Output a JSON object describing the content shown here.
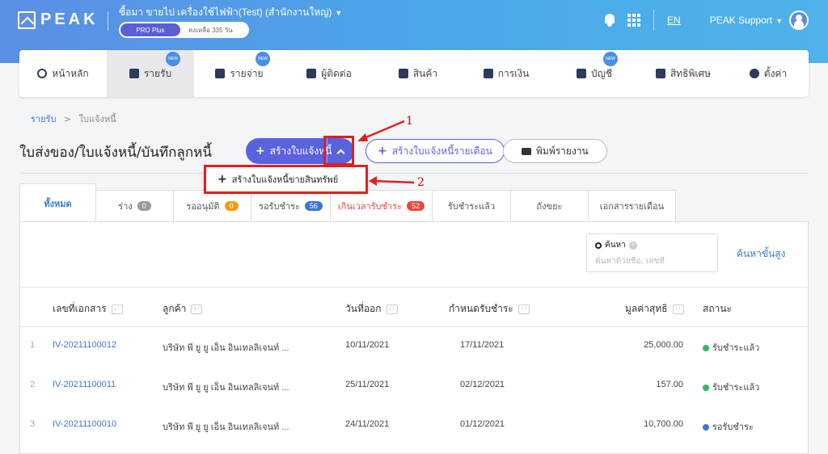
{
  "header": {
    "logo": "PEAK",
    "company": "ซื้อมา ขายไป เครื่องใช้ไฟฟ้า(Test) (สำนักงานใหญ่)",
    "plan": "PRO Plus",
    "days_left": "คงเหลือ 335 วัน",
    "language": "EN",
    "user": "PEAK Support"
  },
  "nav": {
    "items": [
      {
        "label": "หน้าหลัก",
        "icon": "dashboard-icon",
        "new": ""
      },
      {
        "label": "รายรับ",
        "icon": "income-icon",
        "new": "NEW"
      },
      {
        "label": "รายจ่าย",
        "icon": "expense-icon",
        "new": "NEW"
      },
      {
        "label": "ผู้ติดต่อ",
        "icon": "contact-icon",
        "new": ""
      },
      {
        "label": "สินค้า",
        "icon": "product-icon",
        "new": ""
      },
      {
        "label": "การเงิน",
        "icon": "money-icon",
        "new": ""
      },
      {
        "label": "บัญชี",
        "icon": "ledger-icon",
        "new": "NEW"
      },
      {
        "label": "สิทธิพิเศษ",
        "icon": "megaphone-icon",
        "new": ""
      },
      {
        "label": "ตั้งค่า",
        "icon": "gear-icon",
        "new": ""
      }
    ]
  },
  "breadcrumb": {
    "root": "รายรับ",
    "separator": ">",
    "current": "ใบแจ้งหนี้"
  },
  "page": {
    "title": "ใบส่งของ/ใบแจ้งหนี้/บันทึกลูกหนี้",
    "create_label": "สร้างใบแจ้งหนี้",
    "create_monthly_label": "สร้างใบแจ้งหนี้รายเดือน",
    "print_label": "พิมพ์รายงาน"
  },
  "dropdown": {
    "item": "สร้างใบแจ้งหนี้ขายสินทรัพย์"
  },
  "annotations": {
    "one": "1",
    "two": "2"
  },
  "tabs": [
    {
      "label": "ทั้งหมด",
      "count": ""
    },
    {
      "label": "ร่าง",
      "count": "0"
    },
    {
      "label": "รออนุมัติ",
      "count": "0"
    },
    {
      "label": "รอรับชำระ",
      "count": "56"
    },
    {
      "label": "เกินเวลารับชำระ",
      "count": "52"
    },
    {
      "label": "รับชำระแล้ว",
      "count": ""
    },
    {
      "label": "ถังขยะ",
      "count": ""
    },
    {
      "label": "เอกสารรายเดือน",
      "count": ""
    }
  ],
  "colors": {
    "accent": "#5b62e0",
    "link": "#3a78d6",
    "paid": "#2eb86b",
    "pending": "#3a78d6",
    "overdue": "#e84a3a",
    "draft": "#999999",
    "approval": "#f39c12"
  },
  "search": {
    "label": "ค้นหา",
    "placeholder": "ค้นหาด้วยชื่อ, เลขที่",
    "advanced": "ค้นหาขั้นสูง"
  },
  "table": {
    "headers": [
      "เลขที่เอกสาร",
      "ลูกค้า",
      "วันที่ออก",
      "กำหนดรับชำระ",
      "มูลค่าสุทธิ",
      "สถานะ"
    ],
    "rows": [
      {
        "index": "1",
        "doc": "IV-20211100012",
        "customer": "บริษัท พี ยู ยู เอ็น อินเทลลิเจนท์ ...",
        "issue": "10/11/2021",
        "due": "17/11/2021",
        "amount": "25,000.00",
        "status": "รับชำระแล้ว",
        "status_color": "#2eb86b"
      },
      {
        "index": "2",
        "doc": "IV-20211100011",
        "customer": "บริษัท พี ยู ยู เอ็น อินเทลลิเจนท์ ...",
        "issue": "25/11/2021",
        "due": "02/12/2021",
        "amount": "157.00",
        "status": "รับชำระแล้ว",
        "status_color": "#2eb86b"
      },
      {
        "index": "3",
        "doc": "IV-20211100010",
        "customer": "บริษัท พี ยู ยู เอ็น อินเทลลิเจนท์ ...",
        "issue": "24/11/2021",
        "due": "01/12/2021",
        "amount": "10,700.00",
        "status": "รอรับชำระ",
        "status_color": "#3a78d6"
      }
    ]
  }
}
